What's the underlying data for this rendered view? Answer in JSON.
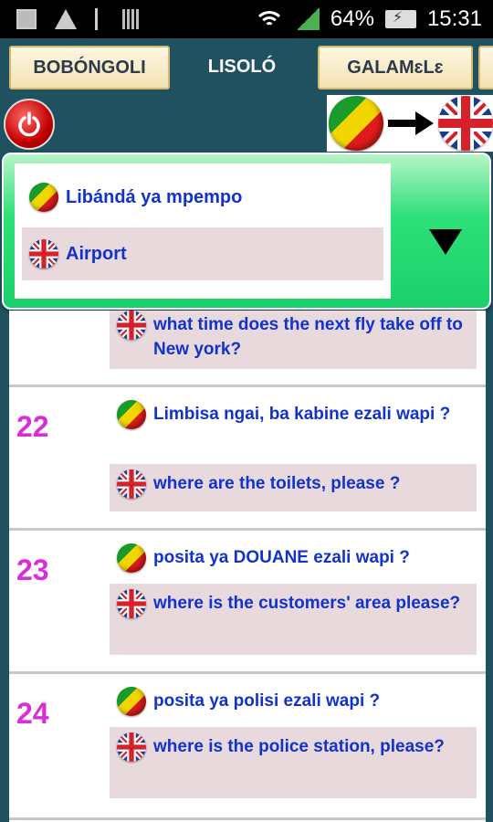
{
  "status_bar": {
    "battery": "64%",
    "time": "15:31"
  },
  "tabs": [
    {
      "label": "BOBÓNGOLI"
    },
    {
      "label": "LISOLÓ"
    },
    {
      "label": "GALAMɛLɛ"
    }
  ],
  "category": {
    "lingala": "Libándá ya mpempo",
    "english": "Airport"
  },
  "entries": [
    {
      "number": "",
      "lingala": "",
      "english": "what time does the next fly take off to New york?"
    },
    {
      "number": "22",
      "lingala": "Limbisa ngai, ba kabine ezali wapi ?",
      "english": "where are the toilets, please ?"
    },
    {
      "number": "23",
      "lingala": "posita ya DOUANE ezali wapi ?",
      "english": "where is the customers' area please?"
    },
    {
      "number": "24",
      "lingala": "posita ya polisi ezali wapi ?",
      "english": "where is the police station, please?"
    }
  ],
  "colors": {
    "number": "#d72ed7",
    "phrase_text": "#1232cc",
    "english_bg": "#e8d9dc",
    "category_green": "#1ad06a",
    "background": "#1f5160"
  }
}
